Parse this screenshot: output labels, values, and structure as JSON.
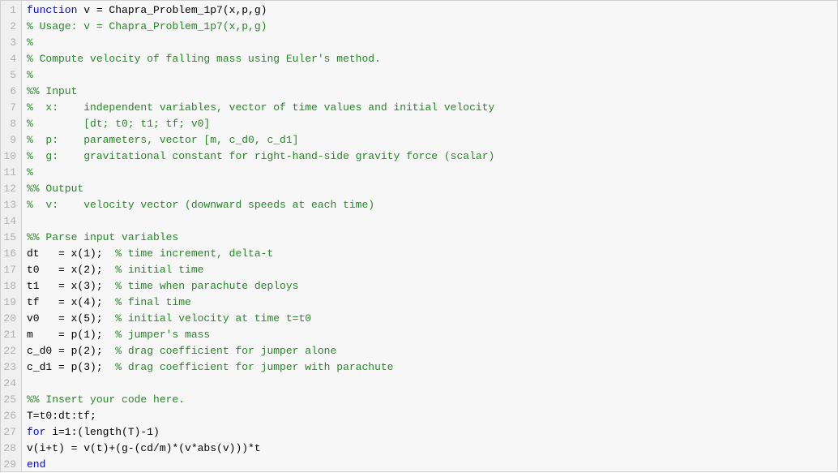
{
  "editor": {
    "lines": [
      {
        "n": 1,
        "segments": [
          {
            "t": "function",
            "c": "kw"
          },
          {
            "t": " v = Chapra_Problem_1p7(x,p,g)",
            "c": "plain"
          }
        ]
      },
      {
        "n": 2,
        "segments": [
          {
            "t": "% Usage: v = Chapra_Problem_1p7(x,p,g)",
            "c": "cm"
          }
        ]
      },
      {
        "n": 3,
        "segments": [
          {
            "t": "%",
            "c": "cm"
          }
        ]
      },
      {
        "n": 4,
        "segments": [
          {
            "t": "% Compute velocity of falling mass using Euler's method.",
            "c": "cm"
          }
        ]
      },
      {
        "n": 5,
        "segments": [
          {
            "t": "%",
            "c": "cm"
          }
        ]
      },
      {
        "n": 6,
        "segments": [
          {
            "t": "%% Input",
            "c": "cm"
          }
        ]
      },
      {
        "n": 7,
        "segments": [
          {
            "t": "%  x:    independent variables, vector of time values and initial velocity",
            "c": "cm"
          }
        ]
      },
      {
        "n": 8,
        "segments": [
          {
            "t": "%        [dt; t0; t1; tf; v0]",
            "c": "cm"
          }
        ]
      },
      {
        "n": 9,
        "segments": [
          {
            "t": "%  p:    parameters, vector [m, c_d0, c_d1]",
            "c": "cm"
          }
        ]
      },
      {
        "n": 10,
        "segments": [
          {
            "t": "%  g:    gravitational constant for right-hand-side gravity force (scalar)",
            "c": "cm"
          }
        ]
      },
      {
        "n": 11,
        "segments": [
          {
            "t": "%",
            "c": "cm"
          }
        ]
      },
      {
        "n": 12,
        "segments": [
          {
            "t": "%% Output",
            "c": "cm"
          }
        ]
      },
      {
        "n": 13,
        "segments": [
          {
            "t": "%  v:    velocity vector (downward speeds at each time)",
            "c": "cm"
          }
        ]
      },
      {
        "n": 14,
        "segments": [
          {
            "t": "",
            "c": "plain"
          }
        ]
      },
      {
        "n": 15,
        "segments": [
          {
            "t": "%% Parse input variables",
            "c": "cm"
          }
        ]
      },
      {
        "n": 16,
        "segments": [
          {
            "t": "dt   = x(1);  ",
            "c": "plain"
          },
          {
            "t": "% time increment, delta-t",
            "c": "cm"
          }
        ]
      },
      {
        "n": 17,
        "segments": [
          {
            "t": "t0   = x(2);  ",
            "c": "plain"
          },
          {
            "t": "% initial time",
            "c": "cm"
          }
        ]
      },
      {
        "n": 18,
        "segments": [
          {
            "t": "t1   = x(3);  ",
            "c": "plain"
          },
          {
            "t": "% time when parachute deploys",
            "c": "cm"
          }
        ]
      },
      {
        "n": 19,
        "segments": [
          {
            "t": "tf   = x(4);  ",
            "c": "plain"
          },
          {
            "t": "% final time",
            "c": "cm"
          }
        ]
      },
      {
        "n": 20,
        "segments": [
          {
            "t": "v0   = x(5);  ",
            "c": "plain"
          },
          {
            "t": "% initial velocity at time t=t0",
            "c": "cm"
          }
        ]
      },
      {
        "n": 21,
        "segments": [
          {
            "t": "m    = p(1);  ",
            "c": "plain"
          },
          {
            "t": "% jumper's mass",
            "c": "cm"
          }
        ]
      },
      {
        "n": 22,
        "segments": [
          {
            "t": "c_d0 = p(2);  ",
            "c": "plain"
          },
          {
            "t": "% drag coefficient for jumper alone",
            "c": "cm"
          }
        ]
      },
      {
        "n": 23,
        "segments": [
          {
            "t": "c_d1 = p(3);  ",
            "c": "plain"
          },
          {
            "t": "% drag coefficient for jumper with parachute",
            "c": "cm"
          }
        ]
      },
      {
        "n": 24,
        "segments": [
          {
            "t": "",
            "c": "plain"
          }
        ]
      },
      {
        "n": 25,
        "segments": [
          {
            "t": "%% Insert your code here.",
            "c": "cm"
          }
        ]
      },
      {
        "n": 26,
        "segments": [
          {
            "t": "T=t0:dt:tf;",
            "c": "plain"
          }
        ]
      },
      {
        "n": 27,
        "segments": [
          {
            "t": "for",
            "c": "kw"
          },
          {
            "t": " i=1:(length(T)-1)",
            "c": "plain"
          }
        ]
      },
      {
        "n": 28,
        "segments": [
          {
            "t": "v(i+t) = v(t)+(g-(cd/m)*(v*abs(v)))*t",
            "c": "plain"
          }
        ]
      },
      {
        "n": 29,
        "segments": [
          {
            "t": "end",
            "c": "kw"
          }
        ]
      }
    ]
  }
}
